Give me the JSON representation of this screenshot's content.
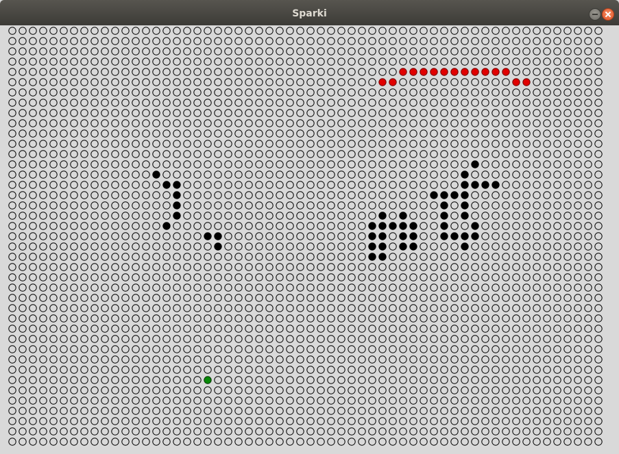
{
  "window": {
    "title": "Sparki"
  },
  "grid": {
    "cols": 58,
    "rows": 41,
    "colors": {
      "background": "#d9d9d9",
      "empty_stroke": "#000000",
      "obstacle": "#000000",
      "path": "#e00000",
      "path_stroke": "#700000",
      "robot": "#0a8a0a"
    },
    "cell_states": [
      "empty",
      "obstacle",
      "path",
      "robot"
    ],
    "obstacles": [
      [
        13,
        45
      ],
      [
        14,
        44
      ],
      [
        15,
        44
      ],
      [
        15,
        45
      ],
      [
        15,
        46
      ],
      [
        15,
        47
      ],
      [
        16,
        41
      ],
      [
        16,
        42
      ],
      [
        16,
        43
      ],
      [
        16,
        44
      ],
      [
        17,
        42
      ],
      [
        17,
        44
      ],
      [
        18,
        42
      ],
      [
        18,
        44
      ],
      [
        19,
        42
      ],
      [
        19,
        45
      ],
      [
        20,
        42
      ],
      [
        20,
        43
      ],
      [
        20,
        44
      ],
      [
        20,
        45
      ],
      [
        21,
        44
      ],
      [
        14,
        14
      ],
      [
        15,
        15
      ],
      [
        15,
        16
      ],
      [
        16,
        16
      ],
      [
        17,
        16
      ],
      [
        18,
        16
      ],
      [
        19,
        15
      ],
      [
        20,
        19
      ],
      [
        20,
        20
      ],
      [
        21,
        20
      ],
      [
        18,
        36
      ],
      [
        18,
        38
      ],
      [
        19,
        35
      ],
      [
        19,
        36
      ],
      [
        19,
        37
      ],
      [
        19,
        38
      ],
      [
        19,
        39
      ],
      [
        20,
        35
      ],
      [
        20,
        36
      ],
      [
        20,
        38
      ],
      [
        20,
        39
      ],
      [
        21,
        35
      ],
      [
        21,
        36
      ],
      [
        21,
        38
      ],
      [
        21,
        39
      ],
      [
        22,
        35
      ],
      [
        22,
        36
      ]
    ],
    "robot": [
      [
        34,
        19
      ]
    ],
    "path": [
      [
        4,
        38
      ],
      [
        4,
        39
      ],
      [
        4,
        40
      ],
      [
        4,
        41
      ],
      [
        4,
        42
      ],
      [
        4,
        43
      ],
      [
        4,
        44
      ],
      [
        4,
        45
      ],
      [
        4,
        46
      ],
      [
        4,
        47
      ],
      [
        4,
        48
      ],
      [
        5,
        36
      ],
      [
        5,
        37
      ],
      [
        5,
        49
      ],
      [
        5,
        50
      ]
    ]
  }
}
